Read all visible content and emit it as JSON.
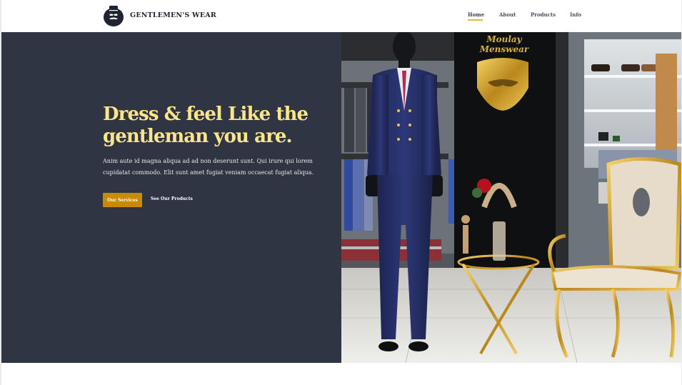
{
  "header": {
    "brand": "GENTLEMEN'S WEAR",
    "logo_icon": "bearded-gentleman-icon",
    "nav": [
      {
        "label": "Home",
        "active": true
      },
      {
        "label": "About",
        "active": false
      },
      {
        "label": "Products",
        "active": false
      },
      {
        "label": "Info",
        "active": false
      }
    ]
  },
  "hero": {
    "title": "Dress & feel Like the gentleman you are.",
    "description": "Anim aute id magna aliqua ad ad non deserunt sunt. Qui irure qui lorem cupidatat commodo. Elit sunt amet fugiat veniam occaecat fugiat aliqua.",
    "primary_button": "Our Services",
    "secondary_link": "See Our Products",
    "photo_sign_line1": "Moulay",
    "photo_sign_line2": "Menswear"
  },
  "colors": {
    "hero_background": "#2f3543",
    "headline": "#fde68a",
    "accent": "#ca8a04",
    "nav_underline": "#e7b63a"
  }
}
